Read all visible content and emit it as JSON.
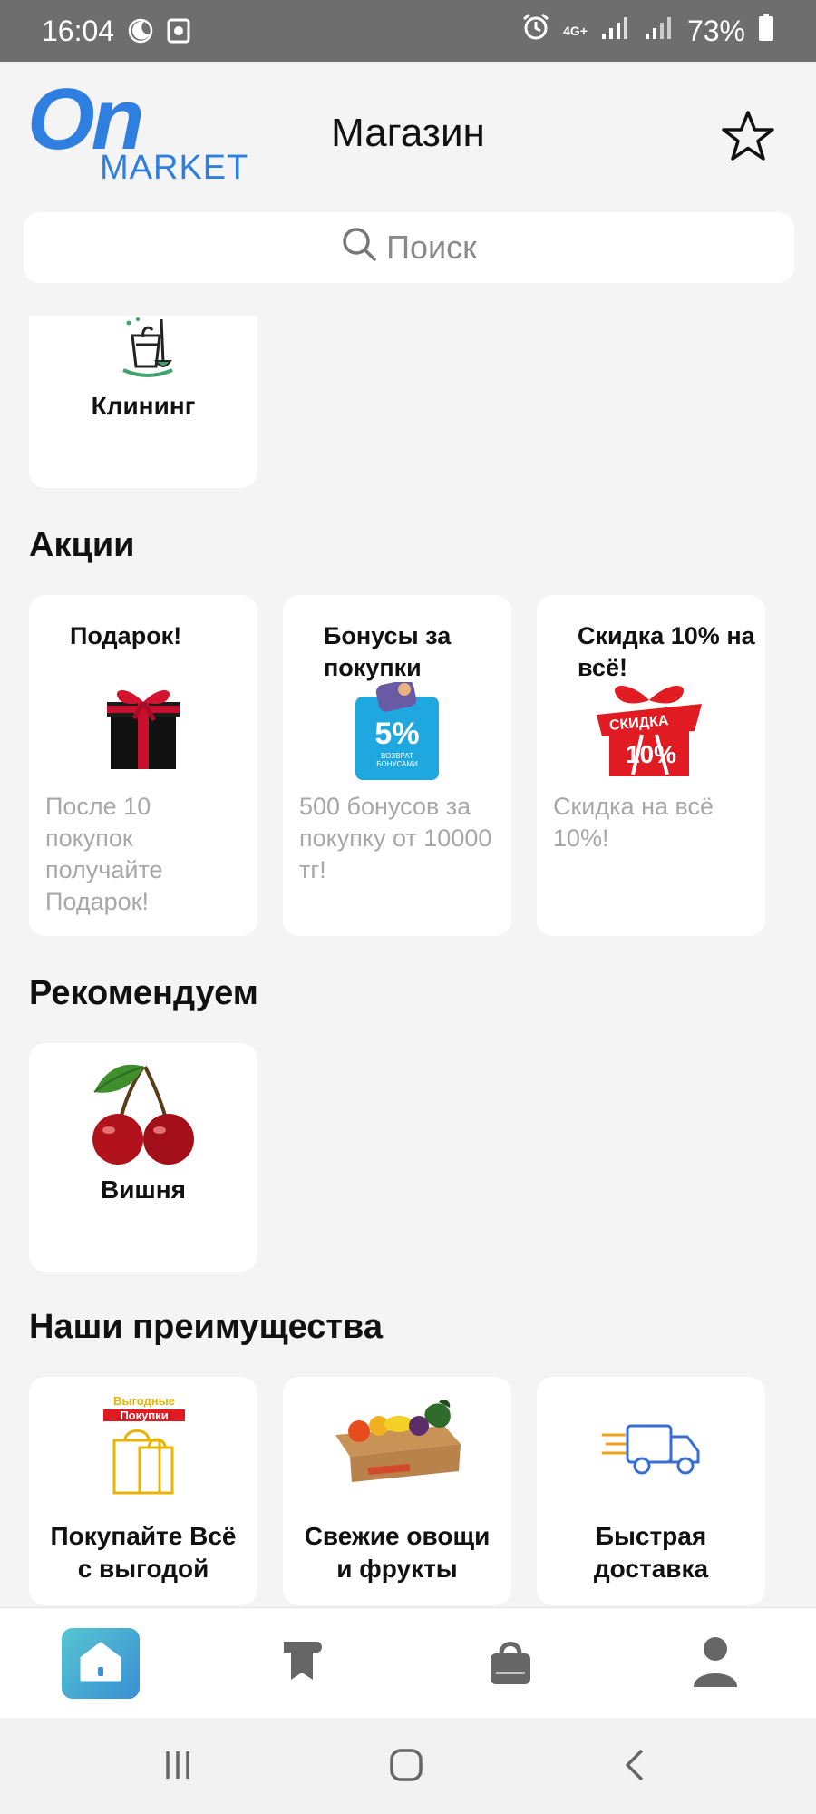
{
  "status_bar": {
    "time": "16:04",
    "network": "4G+",
    "battery": "73%"
  },
  "header": {
    "logo_on": "On",
    "logo_market": "MARKET",
    "title": "Магазин"
  },
  "search": {
    "placeholder": "Поиск"
  },
  "categories": [
    {
      "label": "Клининг",
      "icon": "cleaning-bucket-icon"
    }
  ],
  "promotions": {
    "title": "Акции",
    "items": [
      {
        "title": "Подарок!",
        "desc": "После 10 покупок получайте Подарок!",
        "icon": "gift-box-icon"
      },
      {
        "title": "Бонусы за покупки",
        "desc": "500 бонусов за покупку от 10000 тг!",
        "icon": "cashback-5-percent-icon",
        "badge": "5%",
        "badge_sub": "ВОЗВРАТ БОНУСАМИ"
      },
      {
        "title": "Скидка 10% на всё!",
        "desc": "Скидка на всё 10%!",
        "icon": "discount-10-percent-icon",
        "badge_top": "СКИДКА",
        "badge": "10%"
      }
    ]
  },
  "recommended": {
    "title": "Рекомендуем",
    "items": [
      {
        "label": "Вишня",
        "icon": "cherry-icon"
      }
    ]
  },
  "advantages": {
    "title": "Наши преимущества",
    "items": [
      {
        "label": "Покупайте Всё с выгодой",
        "icon": "shopping-bag-icon",
        "bag_text_1": "Выгодные",
        "bag_text_2": "Покупки"
      },
      {
        "label": "Свежие овощи и фрукты",
        "icon": "vegetable-box-icon"
      },
      {
        "label": "Быстрая доставка",
        "icon": "delivery-truck-icon"
      }
    ]
  },
  "bottom_nav": [
    {
      "name": "home",
      "icon": "home-icon",
      "active": true
    },
    {
      "name": "catalog",
      "icon": "catalog-icon",
      "active": false
    },
    {
      "name": "cart",
      "icon": "shopping-bag-icon",
      "active": false
    },
    {
      "name": "profile",
      "icon": "profile-icon",
      "active": false
    }
  ],
  "colors": {
    "brand": "#2f7fe0",
    "background": "#f4f4f4",
    "card": "#ffffff",
    "muted_text": "#a8a8a8",
    "nav_active_start": "#56c5d2",
    "nav_active_end": "#3a8fd2"
  }
}
